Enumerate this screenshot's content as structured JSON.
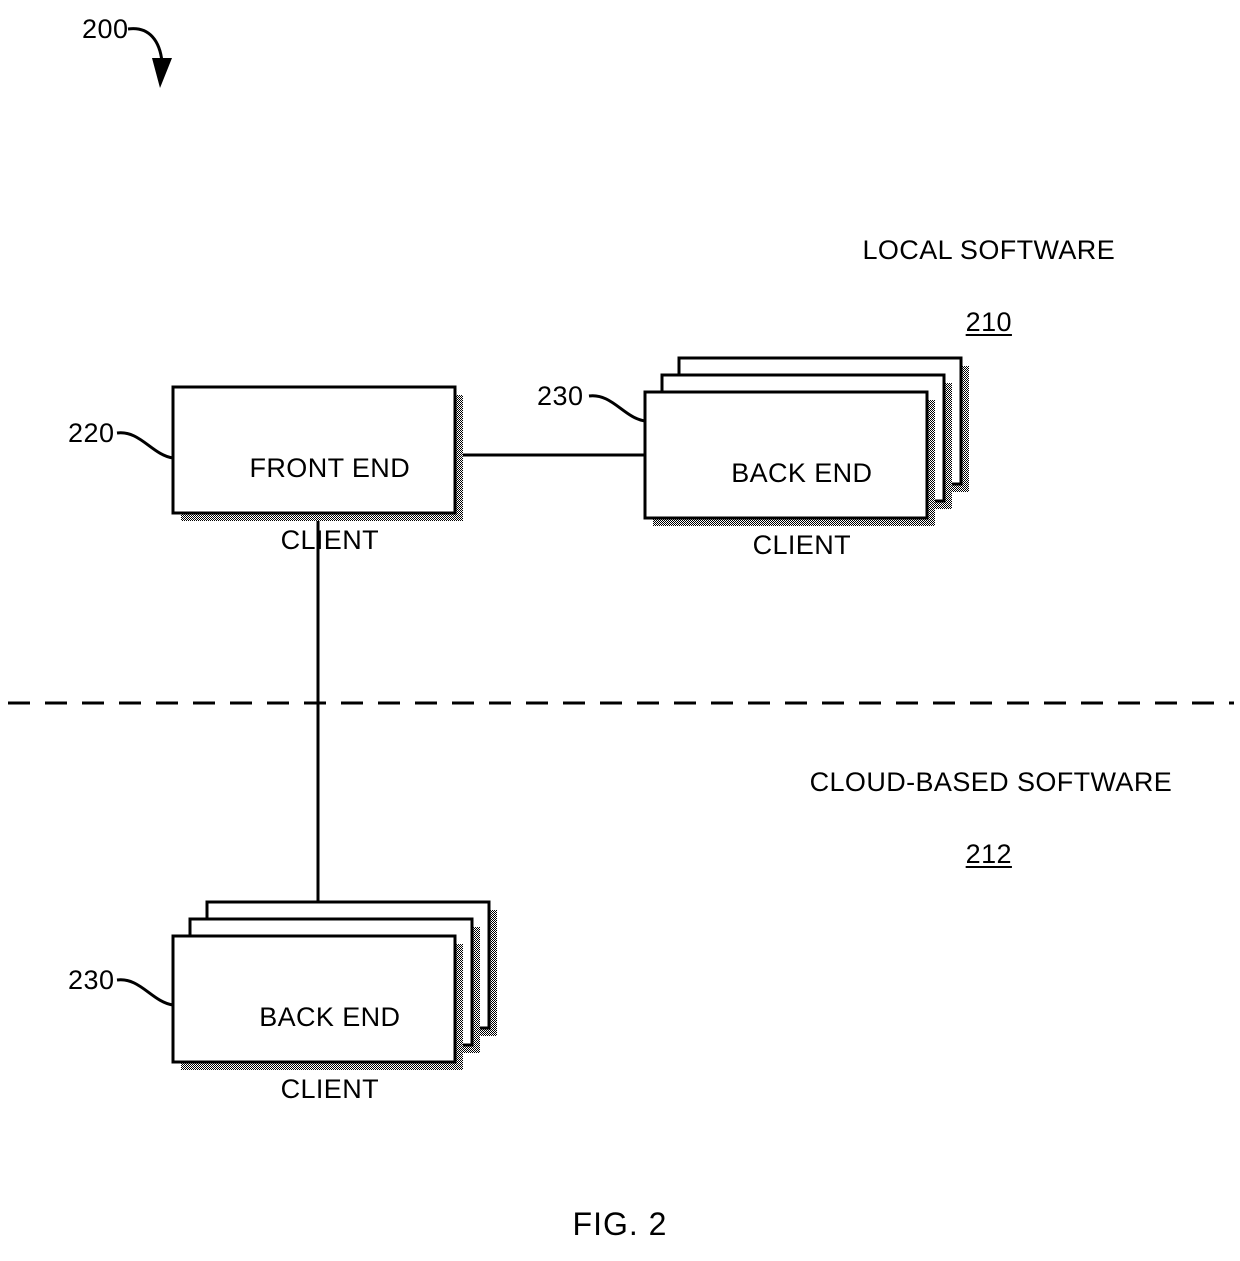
{
  "figure": {
    "caption": "FIG. 2",
    "diagram_ref": "200"
  },
  "regions": [
    {
      "id": "local-software",
      "title": "LOCAL SOFTWARE",
      "ref": "210"
    },
    {
      "id": "cloud-based-software",
      "title": "CLOUD-BASED SOFTWARE",
      "ref": "212"
    }
  ],
  "nodes": [
    {
      "id": "front-end-client",
      "line1": "FRONT END",
      "line2": "CLIENT",
      "ref": "220",
      "stack_count": 1,
      "region": "local-software"
    },
    {
      "id": "back-end-client-local",
      "line1": "BACK END",
      "line2": "CLIENT",
      "ref": "230",
      "stack_count": 3,
      "region": "local-software"
    },
    {
      "id": "back-end-client-cloud",
      "line1": "BACK END",
      "line2": "CLIENT",
      "ref": "230",
      "stack_count": 3,
      "region": "cloud-based-software"
    }
  ],
  "connections": [
    {
      "from": "front-end-client",
      "to": "back-end-client-local"
    },
    {
      "from": "front-end-client",
      "to": "back-end-client-cloud"
    }
  ],
  "divider": {
    "style": "dashed",
    "separates": [
      "local-software",
      "cloud-based-software"
    ]
  },
  "colors": {
    "stroke": "#000000",
    "shadow": "#808080",
    "background": "#ffffff"
  }
}
